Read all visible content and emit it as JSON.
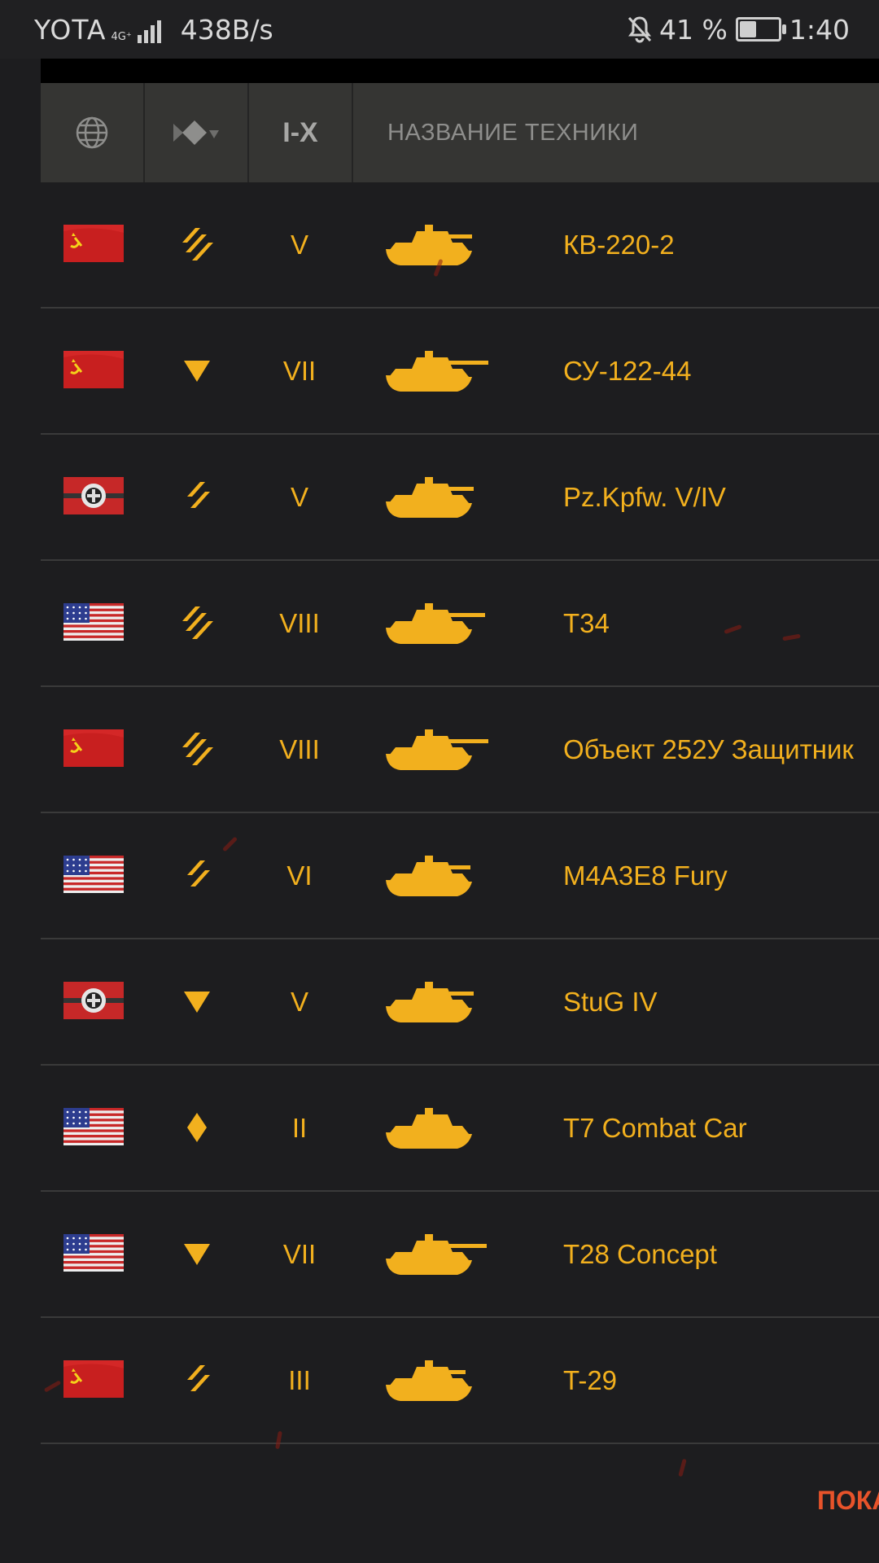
{
  "status_bar": {
    "carrier": "YOTA",
    "network": "4G⁺",
    "speed": "438B/s",
    "battery": "41 %",
    "time": "1:40"
  },
  "header": {
    "tier_label": "I-X",
    "name_label": "НАЗВАНИЕ ТЕХНИКИ"
  },
  "colors": {
    "accent": "#f2b01e",
    "show_more": "#e8532a",
    "background": "#1d1d1f",
    "header_bg": "#353533"
  },
  "vehicles": [
    {
      "nation": "ussr",
      "class": "heavy-tank-icon",
      "tier": "V",
      "name": "КВ-220-2"
    },
    {
      "nation": "ussr",
      "class": "tank-destroyer-icon",
      "tier": "VII",
      "name": "СУ-122-44"
    },
    {
      "nation": "germany",
      "class": "medium-tank-icon",
      "tier": "V",
      "name": "Pz.Kpfw. V/IV"
    },
    {
      "nation": "usa",
      "class": "heavy-tank-icon",
      "tier": "VIII",
      "name": "T34"
    },
    {
      "nation": "ussr",
      "class": "heavy-tank-icon",
      "tier": "VIII",
      "name": "Объект 252У Защитник"
    },
    {
      "nation": "usa",
      "class": "medium-tank-icon",
      "tier": "VI",
      "name": "M4A3E8 Fury"
    },
    {
      "nation": "germany",
      "class": "tank-destroyer-icon",
      "tier": "V",
      "name": "StuG IV"
    },
    {
      "nation": "usa",
      "class": "light-tank-icon",
      "tier": "II",
      "name": "T7 Combat Car"
    },
    {
      "nation": "usa",
      "class": "tank-destroyer-icon",
      "tier": "VII",
      "name": "T28 Concept"
    },
    {
      "nation": "ussr",
      "class": "medium-tank-icon",
      "tier": "III",
      "name": "T-29"
    }
  ],
  "show_more_label": "ПОКА"
}
